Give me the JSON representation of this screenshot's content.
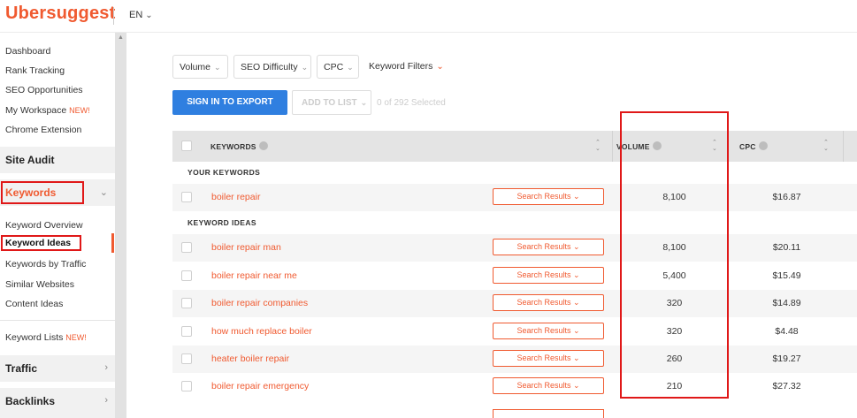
{
  "header": {
    "logo": "Ubersuggest",
    "language": "EN"
  },
  "sidebar": {
    "top_links": [
      {
        "label": "Dashboard"
      },
      {
        "label": "Rank Tracking"
      },
      {
        "label": "SEO Opportunities"
      },
      {
        "label": "My Workspace",
        "badge": "NEW!"
      },
      {
        "label": "Chrome Extension"
      }
    ],
    "sections": {
      "site_audit": "Site Audit",
      "keywords": "Keywords",
      "traffic": "Traffic",
      "backlinks": "Backlinks"
    },
    "keyword_links": [
      {
        "label": "Keyword Overview"
      },
      {
        "label": "Keyword Ideas",
        "active": true
      },
      {
        "label": "Keywords by Traffic"
      },
      {
        "label": "Similar Websites"
      },
      {
        "label": "Content Ideas"
      }
    ],
    "keyword_lists": {
      "label": "Keyword Lists",
      "badge": "NEW!"
    }
  },
  "filters": {
    "volume": "Volume",
    "seo_difficulty": "SEO Difficulty",
    "cpc": "CPC",
    "keyword_filters": "Keyword Filters"
  },
  "actions": {
    "sign_in_export": "SIGN IN TO EXPORT",
    "add_to_list": "ADD TO LIST",
    "selected": "0 of 292 Selected"
  },
  "table": {
    "headers": {
      "keywords": "KEYWORDS",
      "volume": "VOLUME",
      "cpc": "CPC"
    },
    "your_keywords_label": "YOUR KEYWORDS",
    "keyword_ideas_label": "KEYWORD IDEAS",
    "search_results_label": "Search Results",
    "your_keywords": [
      {
        "keyword": "boiler repair",
        "volume": "8,100",
        "cpc": "$16.87"
      }
    ],
    "keyword_ideas": [
      {
        "keyword": "boiler repair man",
        "volume": "8,100",
        "cpc": "$20.11"
      },
      {
        "keyword": "boiler repair near me",
        "volume": "5,400",
        "cpc": "$15.49"
      },
      {
        "keyword": "boiler repair companies",
        "volume": "320",
        "cpc": "$14.89"
      },
      {
        "keyword": "how much replace boiler",
        "volume": "320",
        "cpc": "$4.48"
      },
      {
        "keyword": "heater boiler repair",
        "volume": "260",
        "cpc": "$19.27"
      },
      {
        "keyword": "boiler repair emergency",
        "volume": "210",
        "cpc": "$27.32"
      }
    ]
  },
  "colors": {
    "brand": "#f05a30",
    "primary_button": "#2f7fe0",
    "highlight_box": "#e01818"
  }
}
